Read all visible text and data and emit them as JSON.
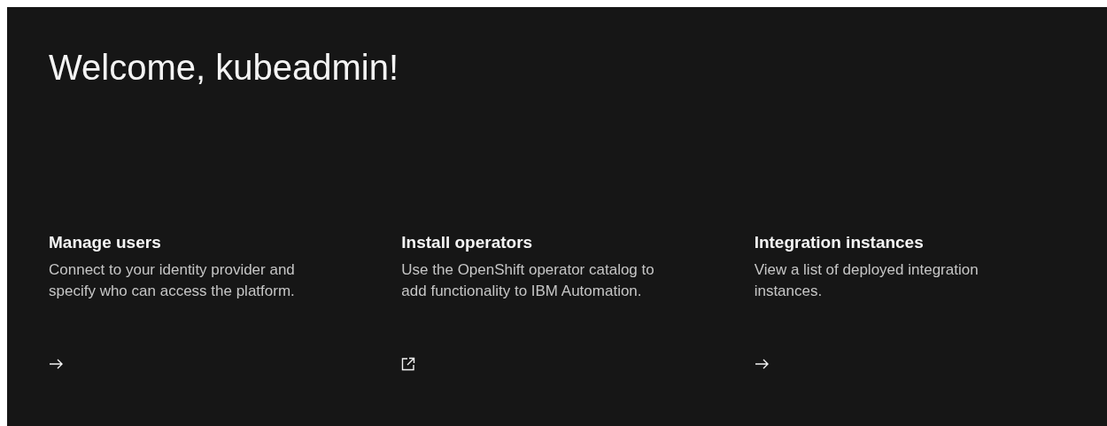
{
  "heading": "Welcome, kubeadmin!",
  "cards": [
    {
      "title": "Manage users",
      "description": "Connect to your identity provider and specify who can access the platform.",
      "kind": "arrow"
    },
    {
      "title": "Install operators",
      "description": "Use the OpenShift operator catalog to add functionality to IBM Automation.",
      "kind": "external"
    },
    {
      "title": "Integration instances",
      "description": "View a list of deployed integration instances.",
      "kind": "arrow"
    }
  ]
}
